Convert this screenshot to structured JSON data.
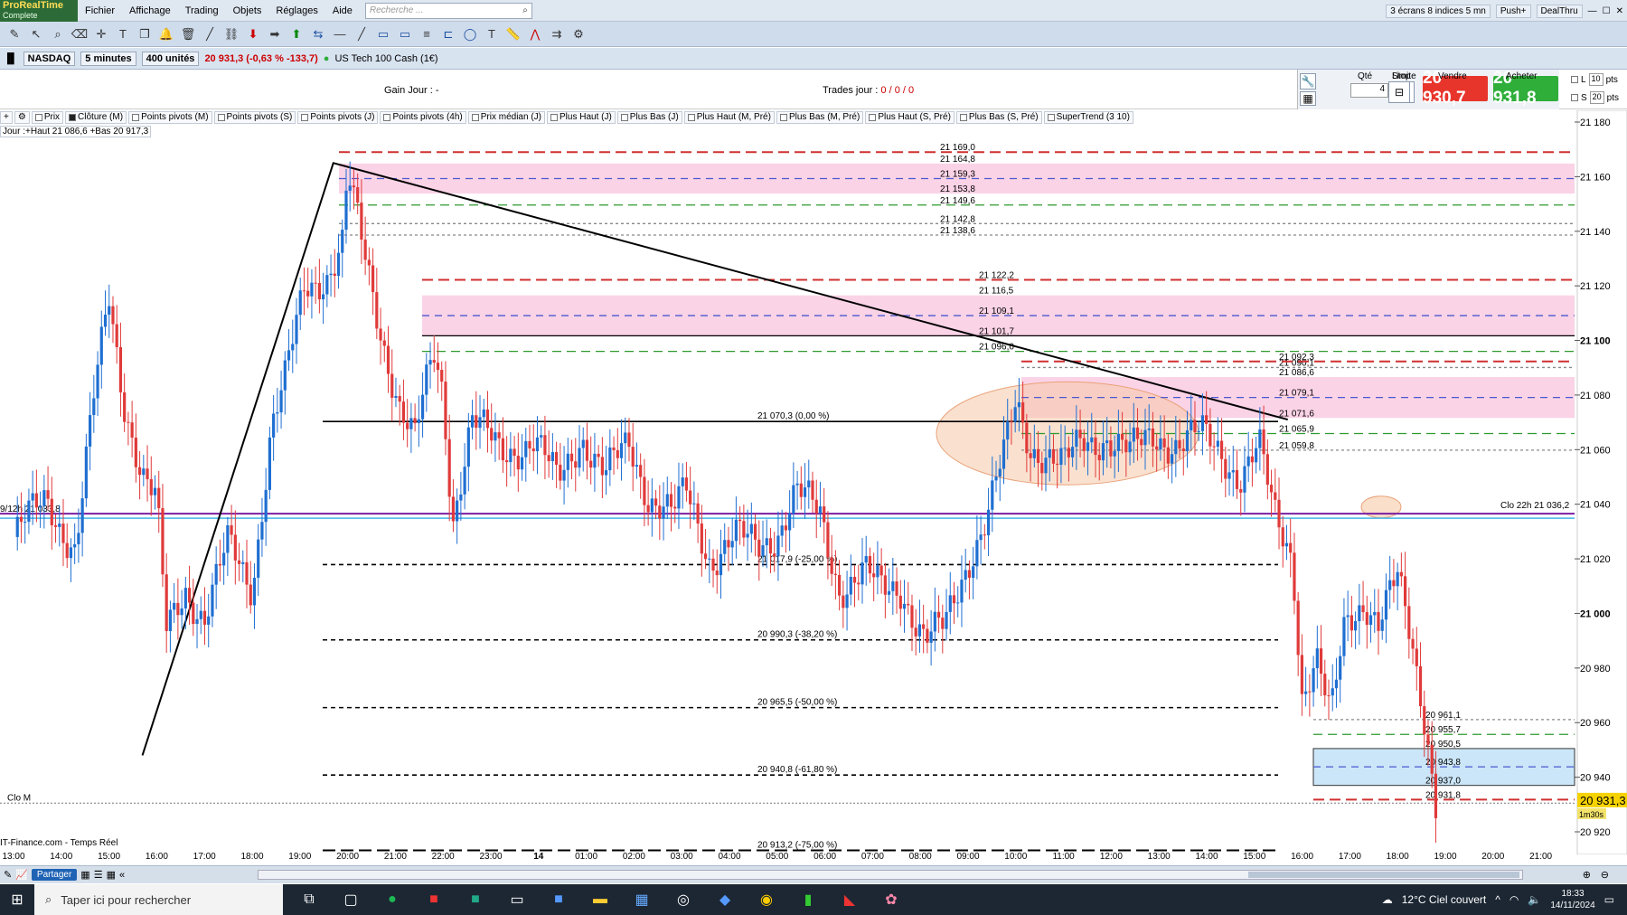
{
  "app": {
    "logo_line1": "ProRealTime",
    "logo_line2": "Complete"
  },
  "menu": [
    "Fichier",
    "Affichage",
    "Trading",
    "Objets",
    "Réglages",
    "Aide"
  ],
  "search": {
    "placeholder": "Recherche ..."
  },
  "topright": {
    "layout": "3 écrans 8 indices 5 mn",
    "push": "Push+",
    "dealthru": "DealThru"
  },
  "instrument": {
    "market": "NASDAQ",
    "timeframe": "5 minutes",
    "units": "400 unités",
    "price_change": "20 931,3 (-0,63 % -133,7)",
    "name": "US Tech 100 Cash (1€)"
  },
  "trade_panel": {
    "gain_label": "Gain Jour :",
    "gain_value": "-",
    "trades_label": "Trades jour :",
    "trades_values": "0 / 0 / 0",
    "qty_label": "Qté",
    "qty_value": "4",
    "limit_label": "Limite",
    "stop_label": "Stop",
    "sell_label": "Vendre",
    "buy_label": "Acheter",
    "sell_price": "20 930,7",
    "buy_price": "20 931,8",
    "l_label": "L",
    "s_label": "S",
    "pts_value": "10",
    "pts_value2": "20",
    "pts_unit": "pts"
  },
  "legend": [
    {
      "label": "Prix",
      "on": false
    },
    {
      "label": "Clôture (M)",
      "on": true
    },
    {
      "label": "Points pivots (M)",
      "on": false
    },
    {
      "label": "Points pivots (S)",
      "on": false
    },
    {
      "label": "Points pivots (J)",
      "on": false
    },
    {
      "label": "Points pivots (4h)",
      "on": false
    },
    {
      "label": "Prix médian (J)",
      "on": false
    },
    {
      "label": "Plus Haut (J)",
      "on": false
    },
    {
      "label": "Plus Bas (J)",
      "on": false
    },
    {
      "label": "Plus Haut (M, Pré)",
      "on": false
    },
    {
      "label": "Plus Bas (M, Pré)",
      "on": false
    },
    {
      "label": "Plus Haut (S, Pré)",
      "on": false
    },
    {
      "label": "Plus Bas (S, Pré)",
      "on": false
    },
    {
      "label": "SuperTrend (3 10)",
      "on": false
    }
  ],
  "jour_label": "Jour :+Haut 21 086,6 +Bas 20 917,3",
  "footer_source": "IT-Finance.com - Temps Réel",
  "share_label": "Partager",
  "chart_data": {
    "type": "candlestick",
    "ylim": [
      20905,
      21185
    ],
    "y_ticks": [
      {
        "v": 21180,
        "t": "21 180"
      },
      {
        "v": 21160,
        "t": "21 160"
      },
      {
        "v": 21140,
        "t": "21 140"
      },
      {
        "v": 21120,
        "t": "21 120"
      },
      {
        "v": 21100,
        "t": "21 100",
        "bold": true
      },
      {
        "v": 21080,
        "t": "21 080"
      },
      {
        "v": 21060,
        "t": "21 060"
      },
      {
        "v": 21040,
        "t": "21 040"
      },
      {
        "v": 21020,
        "t": "21 020"
      },
      {
        "v": 21000,
        "t": "21 000",
        "bold": true
      },
      {
        "v": 20980,
        "t": "20 980"
      },
      {
        "v": 20960,
        "t": "20 960"
      },
      {
        "v": 20940,
        "t": "20 940"
      },
      {
        "v": 20920,
        "t": "20 920"
      }
    ],
    "x_ticks": [
      {
        "i": 0,
        "t": "13:00"
      },
      {
        "i": 1,
        "t": "14:00"
      },
      {
        "i": 2,
        "t": "15:00"
      },
      {
        "i": 3,
        "t": "16:00"
      },
      {
        "i": 4,
        "t": "17:00"
      },
      {
        "i": 5,
        "t": "18:00"
      },
      {
        "i": 6,
        "t": "19:00"
      },
      {
        "i": 7,
        "t": "20:00"
      },
      {
        "i": 8,
        "t": "21:00"
      },
      {
        "i": 9,
        "t": "22:00"
      },
      {
        "i": 10,
        "t": "23:00"
      },
      {
        "i": 11,
        "t": "14",
        "bold": true
      },
      {
        "i": 12,
        "t": "01:00"
      },
      {
        "i": 13,
        "t": "02:00"
      },
      {
        "i": 14,
        "t": "03:00"
      },
      {
        "i": 15,
        "t": "04:00"
      },
      {
        "i": 16,
        "t": "05:00"
      },
      {
        "i": 17,
        "t": "06:00"
      },
      {
        "i": 18,
        "t": "07:00"
      },
      {
        "i": 19,
        "t": "08:00"
      },
      {
        "i": 20,
        "t": "09:00"
      },
      {
        "i": 21,
        "t": "10:00"
      },
      {
        "i": 22,
        "t": "11:00"
      },
      {
        "i": 23,
        "t": "12:00"
      },
      {
        "i": 24,
        "t": "13:00"
      },
      {
        "i": 25,
        "t": "14:00"
      },
      {
        "i": 26,
        "t": "15:00"
      },
      {
        "i": 27,
        "t": "16:00"
      },
      {
        "i": 28,
        "t": "17:00"
      },
      {
        "i": 29,
        "t": "18:00"
      },
      {
        "i": 30,
        "t": "19:00"
      },
      {
        "i": 31,
        "t": "20:00"
      },
      {
        "i": 32,
        "t": "21:00"
      }
    ],
    "price_path": [
      [
        0,
        21028
      ],
      [
        0.7,
        21042
      ],
      [
        1.3,
        21023
      ],
      [
        1.7,
        21080
      ],
      [
        2,
        21116
      ],
      [
        2.3,
        21080
      ],
      [
        2.7,
        21050
      ],
      [
        3,
        21040
      ],
      [
        3.2,
        20993
      ],
      [
        3.6,
        21010
      ],
      [
        4,
        20998
      ],
      [
        4.5,
        21025
      ],
      [
        5,
        21010
      ],
      [
        5.4,
        21068
      ],
      [
        5.7,
        21085
      ],
      [
        6.1,
        21120
      ],
      [
        6.6,
        21125
      ],
      [
        6.9,
        21135
      ],
      [
        7.0,
        21160
      ],
      [
        7.3,
        21135
      ],
      [
        7.7,
        21104
      ],
      [
        8.1,
        21075
      ],
      [
        8.4,
        21062
      ],
      [
        8.8,
        21096
      ],
      [
        9.0,
        21082
      ],
      [
        9.2,
        21035
      ],
      [
        9.6,
        21070
      ],
      [
        10.2,
        21060
      ],
      [
        10.9,
        21063
      ],
      [
        11.4,
        21048
      ],
      [
        11.9,
        21066
      ],
      [
        12.4,
        21050
      ],
      [
        12.9,
        21062
      ],
      [
        13.3,
        21044
      ],
      [
        13.8,
        21036
      ],
      [
        14.1,
        21044
      ],
      [
        14.6,
        21020
      ],
      [
        15.1,
        21028
      ],
      [
        15.6,
        21024
      ],
      [
        16.0,
        21030
      ],
      [
        16.4,
        21045
      ],
      [
        16.9,
        21035
      ],
      [
        17.3,
        21010
      ],
      [
        17.8,
        21015
      ],
      [
        18.2,
        21008
      ],
      [
        18.6,
        21010
      ],
      [
        19.1,
        20990
      ],
      [
        19.5,
        20994
      ],
      [
        20.0,
        21020
      ],
      [
        20.4,
        21036
      ],
      [
        20.8,
        21060
      ],
      [
        21.0,
        21077
      ],
      [
        21.3,
        21062
      ],
      [
        21.7,
        21058
      ],
      [
        22.0,
        21053
      ],
      [
        22.4,
        21063
      ],
      [
        22.9,
        21065
      ],
      [
        23.4,
        21058
      ],
      [
        23.9,
        21066
      ],
      [
        24.4,
        21062
      ],
      [
        24.9,
        21065
      ],
      [
        25.3,
        21060
      ],
      [
        25.7,
        21050
      ],
      [
        26.1,
        21060
      ],
      [
        26.4,
        21037
      ],
      [
        26.8,
        21022
      ],
      [
        27.0,
        20970
      ],
      [
        27.3,
        20982
      ],
      [
        27.6,
        20960
      ],
      [
        27.9,
        20998
      ],
      [
        28.3,
        21006
      ],
      [
        28.6,
        20995
      ],
      [
        29.0,
        21012
      ],
      [
        29.3,
        20990
      ],
      [
        29.6,
        20960
      ],
      [
        29.8,
        20931
      ]
    ],
    "horizontal_levels": [
      {
        "v": 21169.0,
        "t": "21 169,0",
        "color": "#d03030",
        "dash": "12 6"
      },
      {
        "v": 21164.8,
        "t": "21 164,8"
      },
      {
        "v": 21159.3,
        "t": "21 159,3",
        "color": "#4a5ad0",
        "dash": "8 6"
      },
      {
        "v": 21153.8,
        "t": "21 153,8"
      },
      {
        "v": 21149.6,
        "t": "21 149,6",
        "color": "#2e9a2e",
        "dash": "10 6"
      },
      {
        "v": 21142.8,
        "t": "21 142,8",
        "color": "#888",
        "dash": "3 3"
      },
      {
        "v": 21138.6,
        "t": "21 138,6",
        "color": "#888",
        "dash": "3 3"
      },
      {
        "v": 21122.2,
        "t": "21 122,2",
        "color": "#d03030",
        "dash": "12 6"
      },
      {
        "v": 21116.5,
        "t": "21 116,5"
      },
      {
        "v": 21109.1,
        "t": "21 109,1",
        "color": "#4a5ad0",
        "dash": "8 6"
      },
      {
        "v": 21101.7,
        "t": "21 101,7",
        "color": "#000",
        "dash": ""
      },
      {
        "v": 21096.0,
        "t": "21 096,0",
        "color": "#2e9a2e",
        "dash": "10 6"
      },
      {
        "v": 21090.1,
        "t": "21 090,1",
        "color": "#888",
        "dash": "3 3"
      },
      {
        "v": 21092.3,
        "t": "21 092,3",
        "color": "#d03030",
        "dash": "12 6"
      },
      {
        "v": 21086.6,
        "t": "21 086,6"
      },
      {
        "v": 21079.1,
        "t": "21 079,1",
        "color": "#4a5ad0",
        "dash": "8 6"
      },
      {
        "v": 21071.6,
        "t": "21 071,6"
      },
      {
        "v": 21065.9,
        "t": "21 065,9",
        "color": "#2e9a2e",
        "dash": "10 6"
      },
      {
        "v": 21059.8,
        "t": "21 059,8",
        "color": "#888",
        "dash": "3 3"
      },
      {
        "v": 20961.1,
        "t": "20 961,1",
        "color": "#888",
        "dash": "3 3"
      },
      {
        "v": 20955.7,
        "t": "20 955,7",
        "color": "#2e9a2e",
        "dash": "10 6"
      },
      {
        "v": 20950.5,
        "t": "20 950,5"
      },
      {
        "v": 20943.8,
        "t": "20 943,8",
        "color": "#4a5ad0",
        "dash": "8 6"
      },
      {
        "v": 20937.0,
        "t": "20 937,0"
      },
      {
        "v": 20931.8,
        "t": "20 931,8",
        "color": "#d03030",
        "dash": "12 6"
      }
    ],
    "fibonacci": [
      {
        "v": 21070.3,
        "t": "21 070,3 (0,00 %)"
      },
      {
        "v": 21017.9,
        "t": "21 017,9 (-25,00 %)"
      },
      {
        "v": 20990.3,
        "t": "20 990,3 (-38,20 %)"
      },
      {
        "v": 20965.5,
        "t": "20 965,5 (-50,00 %)"
      },
      {
        "v": 20940.8,
        "t": "20 940,8 (-61,80 %)"
      },
      {
        "v": 20913.2,
        "t": "20 913,2 (-75,00 %)"
      }
    ],
    "close_22h": {
      "v": 21036.2,
      "t": "Clo 22h 21 036,2",
      "left_label": "9/12h 21 033,8"
    },
    "close_m": {
      "v": 20930.5,
      "t": "Clo M"
    },
    "current_price": {
      "v": 20931.3,
      "t": "20 931,3",
      "timer": "1m30s"
    },
    "colors": {
      "up": "#1f6fd1",
      "down": "#e03a3a",
      "pink_zone": "#fbd3e6",
      "blue_zone": "#cbe6f8",
      "ellipse": "#f6c9a7",
      "accent_bar": "#f6d300"
    }
  },
  "taskbar": {
    "search_placeholder": "Taper ici pour rechercher",
    "weather": "12°C  Ciel couvert",
    "time": "18:33",
    "date": "14/11/2024"
  }
}
